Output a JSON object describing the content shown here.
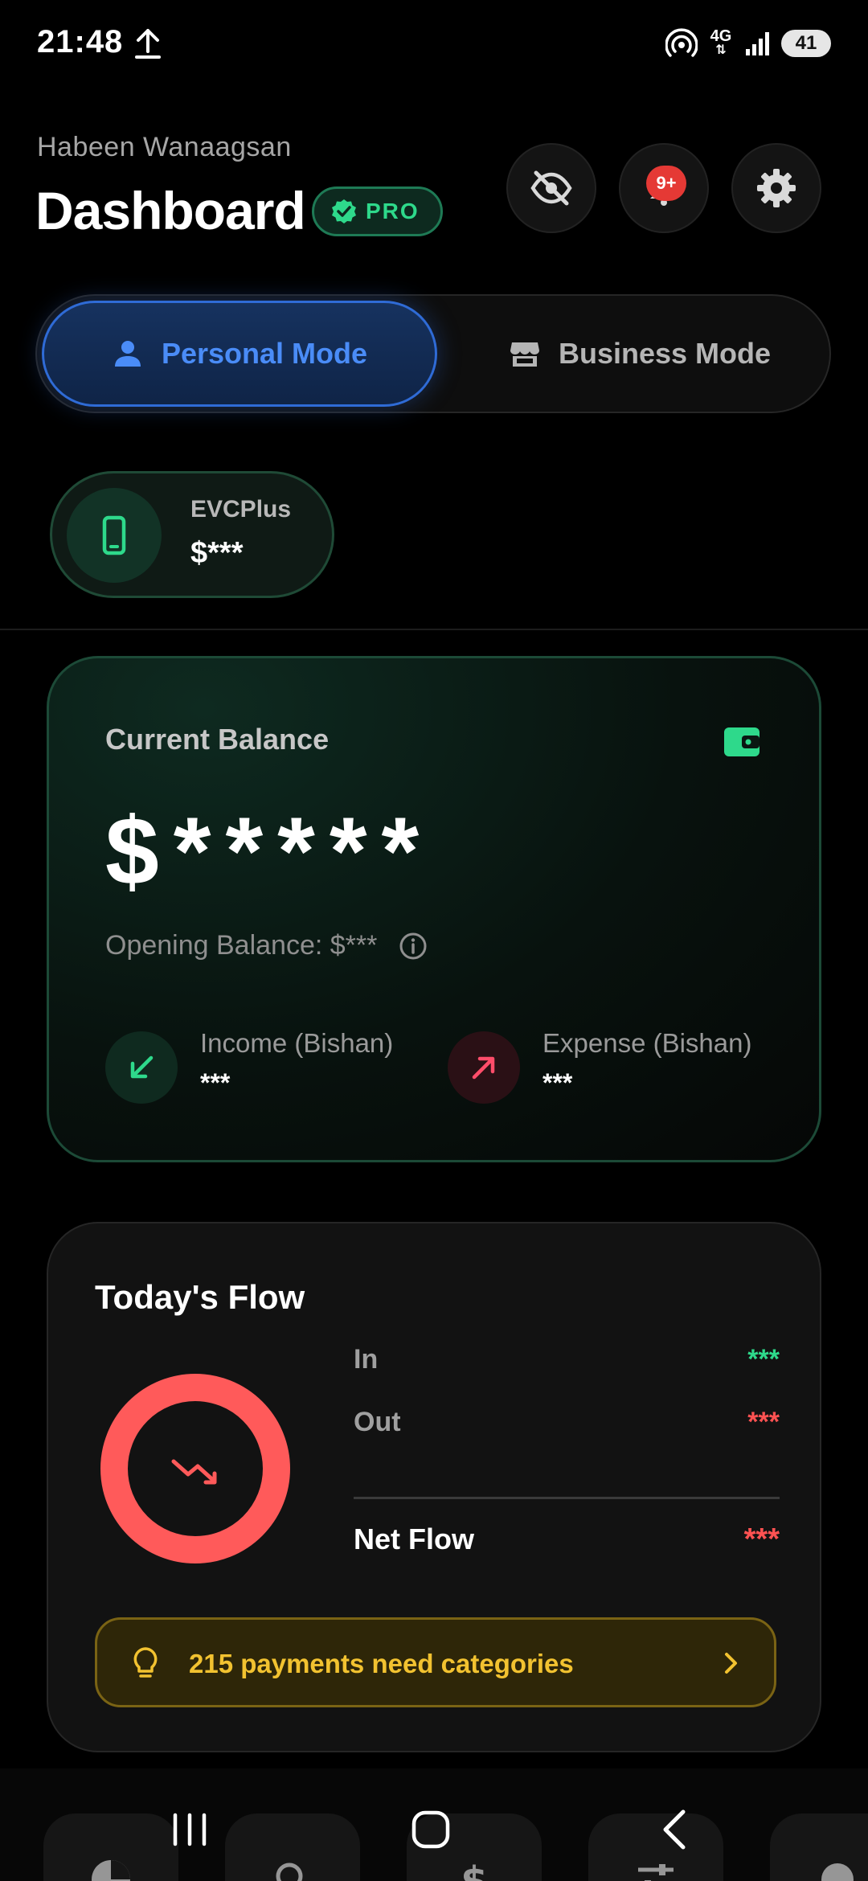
{
  "status_bar": {
    "time": "21:48",
    "network": "4G",
    "battery": "41",
    "icons": [
      "upload-icon",
      "hotspot-icon",
      "signal-icon",
      "battery-icon"
    ]
  },
  "header": {
    "username": "Habeen Wanaagsan",
    "title": "Dashboard",
    "badge": "PRO",
    "notification_count": "9+"
  },
  "mode_switch": {
    "personal": "Personal Mode",
    "business": "Business Mode",
    "active": "personal"
  },
  "account": {
    "name": "EVCPlus",
    "balance": "$***"
  },
  "balance_card": {
    "label": "Current Balance",
    "amount": "$*****",
    "opening": "Opening Balance: $***",
    "income_label": "Income (Bishan)",
    "income_value": "***",
    "expense_label": "Expense (Bishan)",
    "expense_value": "***"
  },
  "flow_card": {
    "title": "Today's Flow",
    "in_label": "In",
    "in_value": "***",
    "out_label": "Out",
    "out_value": "***",
    "net_label": "Net Flow",
    "net_value": "***",
    "alert": "215 payments need categories"
  },
  "colors": {
    "accent_blue": "#4a8cf7",
    "accent_green": "#2ed98b",
    "accent_red": "#ff5252",
    "alert_yellow": "#f2c230"
  }
}
